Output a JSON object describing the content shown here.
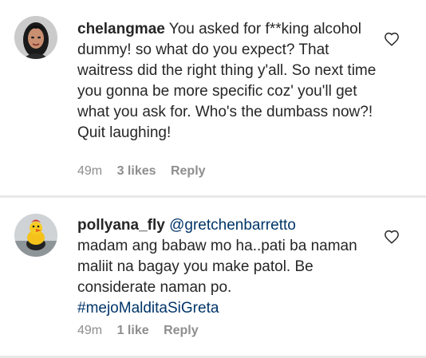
{
  "comments": [
    {
      "username": "chelangmae",
      "mention": "",
      "text": " You asked for f**king alcohol dummy! so what do you expect? That waitress did the right thing y'all. So next time you gonna be more specific coz' you'll get what you ask for. Who's the dumbass now?! Quit laughing!",
      "hashtag": "",
      "time": "49m",
      "likes": "3 likes",
      "reply": "Reply",
      "avatar_icon": "woman-portrait-avatar",
      "like_icon": "heart-outline-icon"
    },
    {
      "username": "pollyana_fly",
      "mention": "@gretchenbarretto",
      "text": "madam ang babaw mo ha..pati ba naman maliit na bagay you make patol. Be considerate naman po.",
      "hashtag": "#mejoMalditaSiGreta",
      "time": "49m",
      "likes": "1 like",
      "reply": "Reply",
      "avatar_icon": "yellow-duck-toy-avatar",
      "like_icon": "heart-outline-icon"
    }
  ],
  "colors": {
    "text": "#262626",
    "link": "#003569",
    "meta": "#8e8e8e",
    "divider": "#e8e8e8"
  }
}
